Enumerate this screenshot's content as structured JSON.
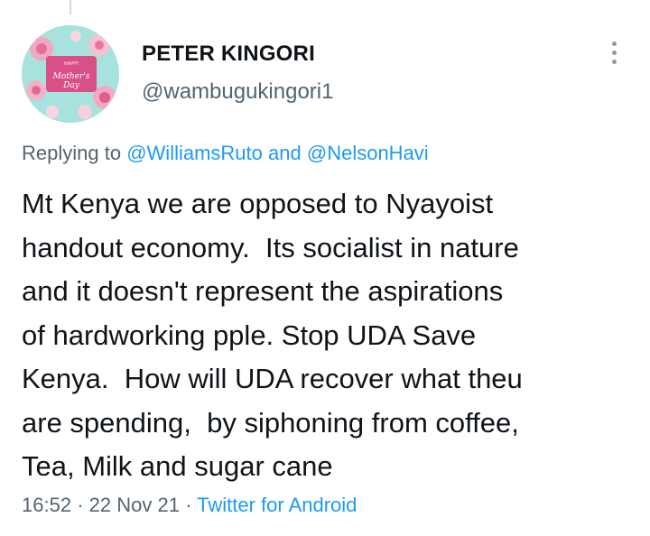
{
  "tweet": {
    "author": {
      "name": "PETER KINGORI",
      "handle": "@wambugukingori1",
      "avatar_text_small": "HAPPY",
      "avatar_text": "Mother's Day"
    },
    "reply_prefix": "Replying to",
    "reply_to_1": "@WilliamsRuto",
    "reply_and": "and",
    "reply_to_2": "@NelsonHavi",
    "text": "Mt Kenya we are opposed to Nyayoist\nhandout economy.  Its socialist in nature\nand it doesn't represent the aspirations\nof hardworking pple. Stop UDA Save\nKenya.  How will UDA recover what theu\nare spending,  by siphoning from coffee,\nTea, Milk and sugar cane",
    "time": "16:52",
    "separator": "·",
    "date": "22 Nov 21",
    "source": "Twitter for Android"
  },
  "icons": {
    "more": "more-vertical-icon"
  },
  "colors": {
    "accent": "#1d9bf0",
    "text": "#0f1419",
    "secondary": "#536471"
  }
}
